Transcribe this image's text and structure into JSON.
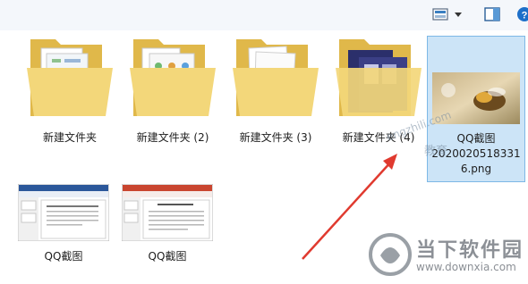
{
  "toolbar": {
    "view_icon": "view-options-icon",
    "dropdown_icon": "chevron-down-icon",
    "pane_icon": "preview-pane-icon",
    "help_icon": "help-icon"
  },
  "folders": [
    {
      "label": "新建文件夹"
    },
    {
      "label": "新建文件夹 (2)"
    },
    {
      "label": "新建文件夹 (3)"
    },
    {
      "label": "新建文件夹 (4)"
    }
  ],
  "selected_file": {
    "name": "QQ截图",
    "name_line2": "2020020518331",
    "name_line3": "6.png"
  },
  "screenshots": [
    {
      "label": "QQ截图"
    },
    {
      "label": "QQ截图"
    }
  ],
  "watermark": {
    "url": "engzhili.com",
    "text": "教育"
  },
  "logo": {
    "name": "当下软件园",
    "url": "www.downxia.com"
  },
  "colors": {
    "folder": "#f3d77a",
    "folder_dark": "#e0b84a",
    "selection_bg": "#cce4f7",
    "selection_border": "#7db8e6",
    "arrow": "#e03a2f"
  }
}
